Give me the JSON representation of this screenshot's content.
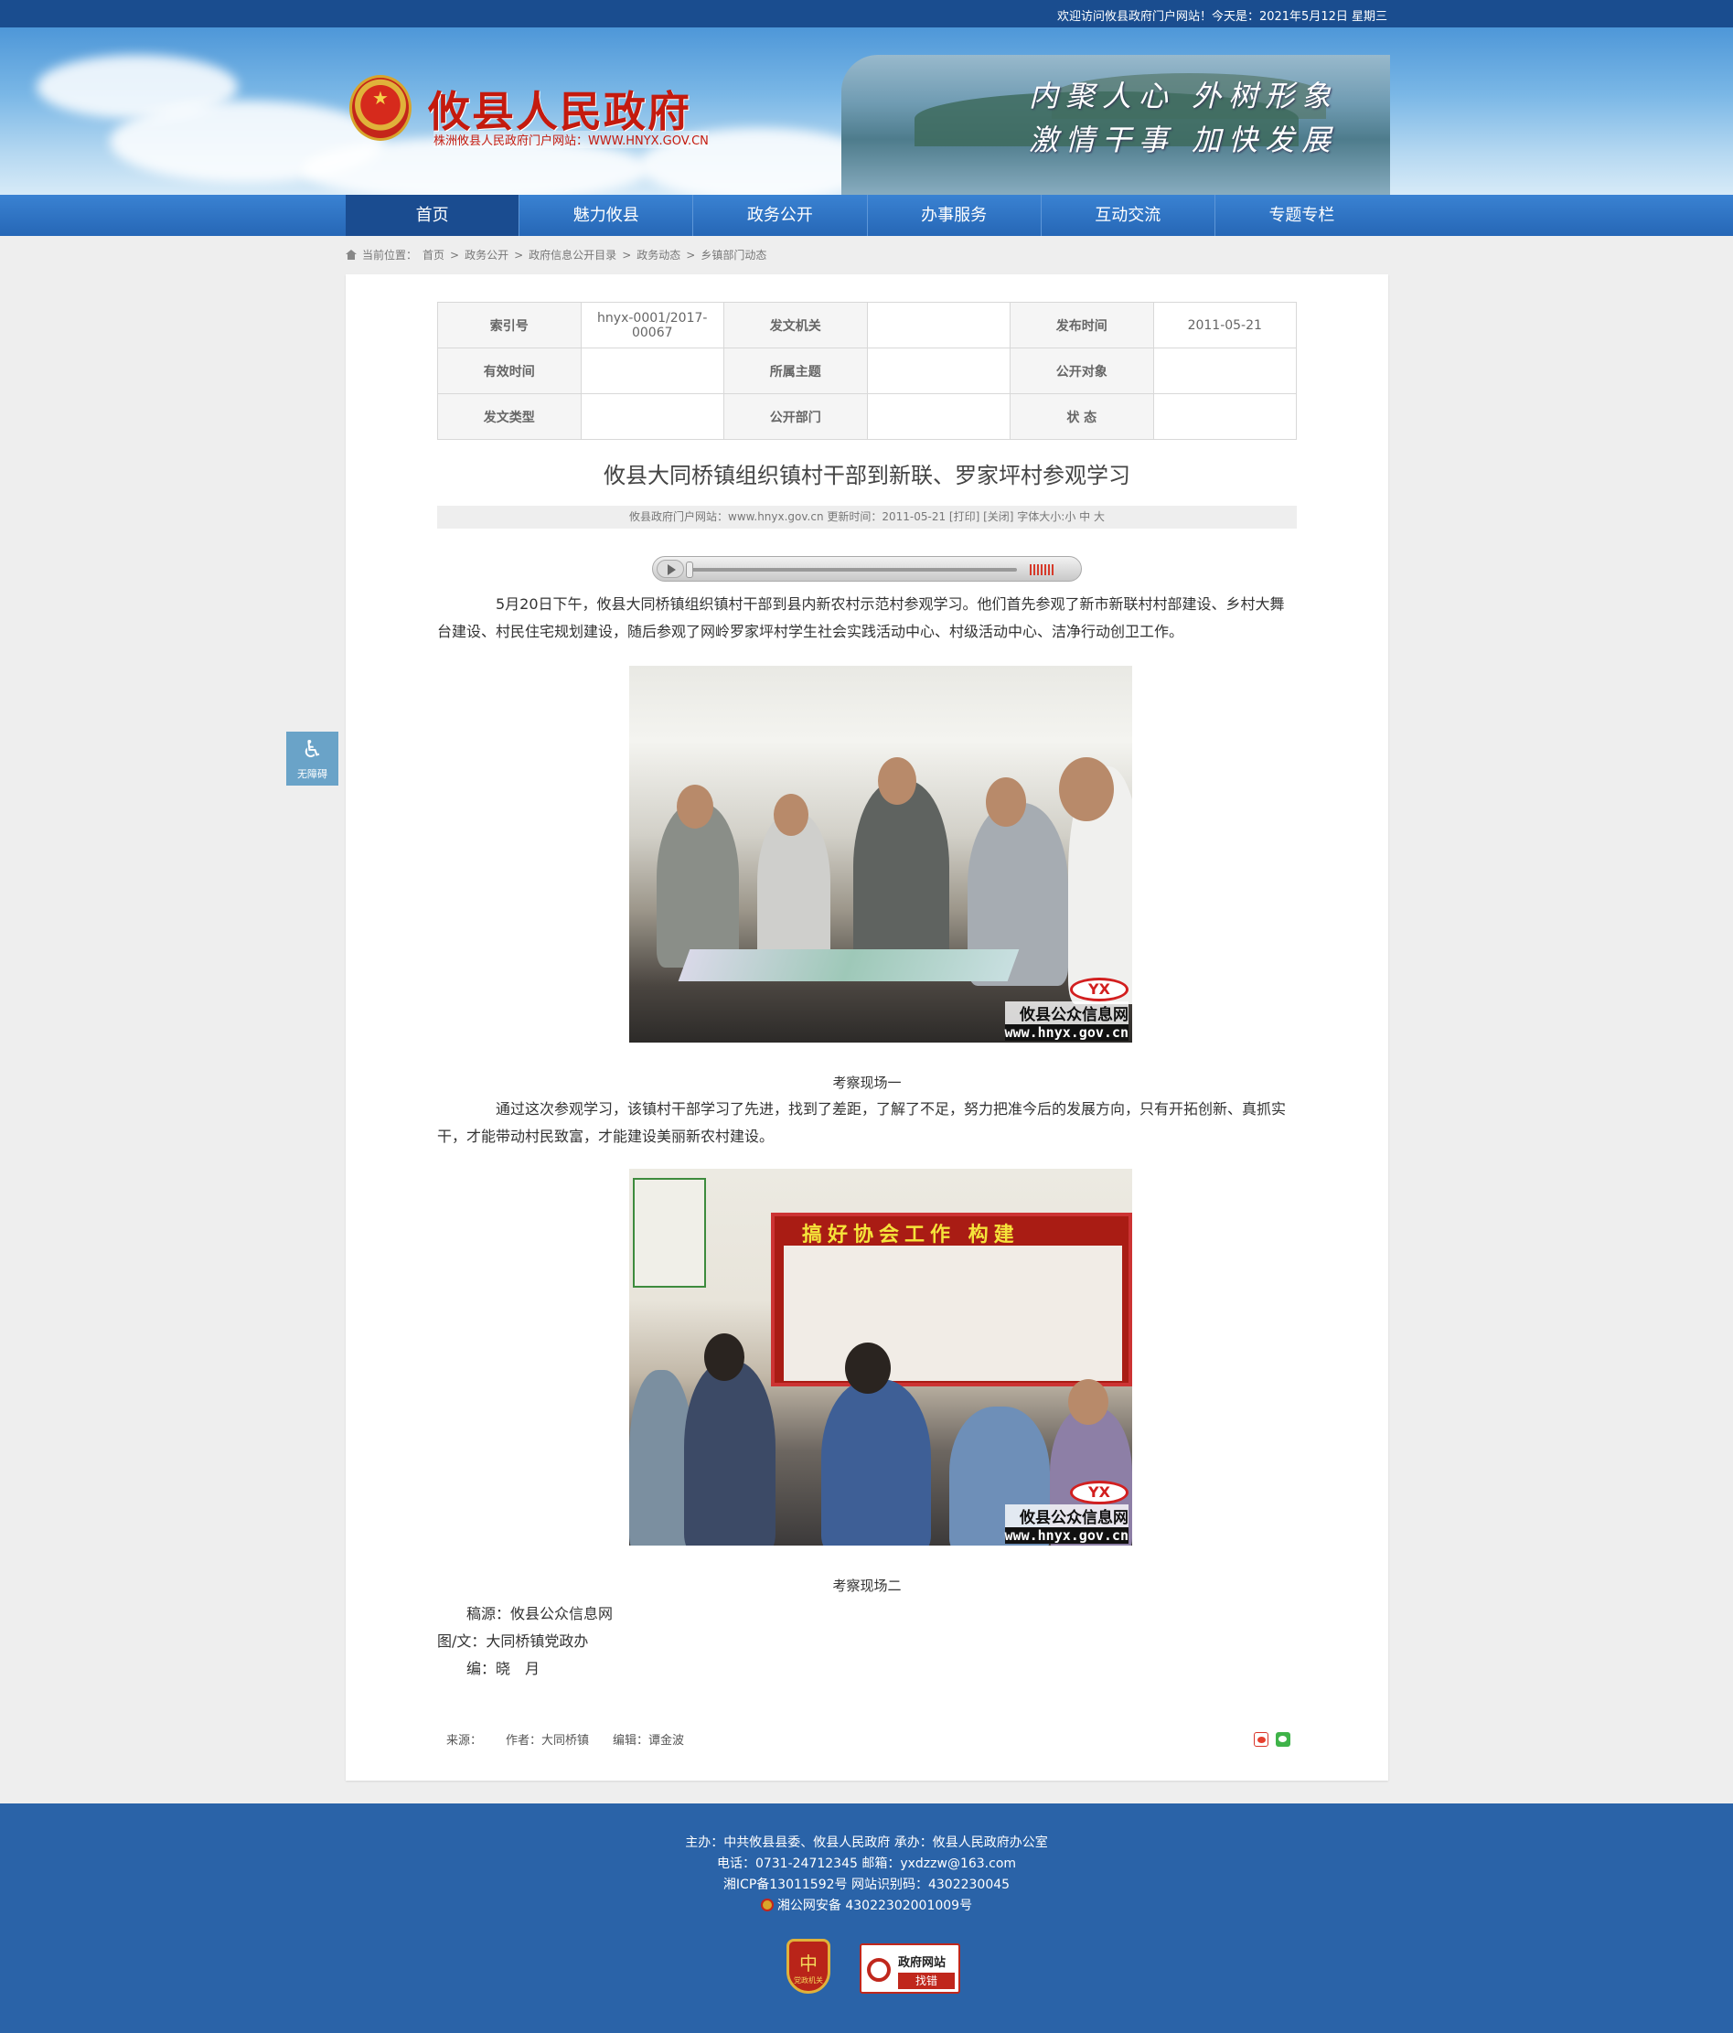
{
  "topbar": {
    "greeting": "欢迎访问攸县政府门户网站！今天是：2021年5月12日 星期三"
  },
  "header": {
    "site_title": "攸县人民政府",
    "site_subtitle": "株洲攸县人民政府门户网站：WWW.HNYX.GOV.CN",
    "slogan_line1": "内聚人心 外树形象",
    "slogan_line2": "激情干事 加快发展"
  },
  "nav": {
    "items": [
      "首页",
      "魅力攸县",
      "政务公开",
      "办事服务",
      "互动交流",
      "专题专栏"
    ],
    "active_index": 0
  },
  "breadcrumb": {
    "prefix": "当前位置：",
    "items": [
      "首页",
      "政务公开",
      "政府信息公开目录",
      "政务动态",
      "乡镇部门动态"
    ],
    "separator": ">"
  },
  "meta_table": {
    "rows": [
      [
        {
          "k": "索引号",
          "v": "hnyx-0001/2017-00067"
        },
        {
          "k": "发文机关",
          "v": ""
        },
        {
          "k": "发布时间",
          "v": "2011-05-21"
        }
      ],
      [
        {
          "k": "有效时间",
          "v": ""
        },
        {
          "k": "所属主题",
          "v": ""
        },
        {
          "k": "公开对象",
          "v": ""
        }
      ],
      [
        {
          "k": "发文类型",
          "v": ""
        },
        {
          "k": "公开部门",
          "v": ""
        },
        {
          "k": "状 态",
          "v": ""
        }
      ]
    ]
  },
  "article": {
    "title": "攸县大同桥镇组织镇村干部到新联、罗家坪村参观学习",
    "info": "攸县政府门户网站：www.hnyx.gov.cn  更新时间：2011-05-21  [打印]  [关闭]  字体大小:小 中 大",
    "para1": "5月20日下午，攸县大同桥镇组织镇村干部到县内新农村示范村参观学习。他们首先参观了新市新联村村部建设、乡村大舞台建设、村民住宅规划建设，随后参观了网岭罗家坪村学生社会实践活动中心、村级活动中心、洁净行动创卫工作。",
    "caption1": "考察现场一",
    "para2": "通过这次参观学习，该镇村干部学习了先进，找到了差距，了解了不足，努力把准今后的发展方向，只有开拓创新、真抓实干，才能带动村民致富，才能建设美丽新农村建设。",
    "caption2": "考察现场二",
    "credit_source": "稿源：攸县公众信息网",
    "credit_author": "图/文：大同桥镇党政办",
    "credit_editor": "编：晓　月",
    "photo_watermark_logo": "YX",
    "photo_watermark_name": "攸县公众信息网",
    "photo_watermark_url": "www.hnyx.gov.cn",
    "poster_title": "搞好协会工作 构建"
  },
  "article_footer": {
    "source": "来源：",
    "author": "作者：大同桥镇",
    "editor": "编辑：谭金波"
  },
  "accessibility": {
    "label": "无障碍"
  },
  "footer": {
    "line1": "主办：中共攸县县委、攸县人民政府 承办：攸县人民政府办公室",
    "line2": "电话：0731-24712345 邮箱：yxdzzw@163.com",
    "line3": "湘ICP备13011592号    网站识别码：4302230045",
    "line4": "湘公网安备 43022302001009号",
    "badge1_label": "党政机关",
    "badge2_line1": "政府网站",
    "badge2_line2": "找错"
  }
}
